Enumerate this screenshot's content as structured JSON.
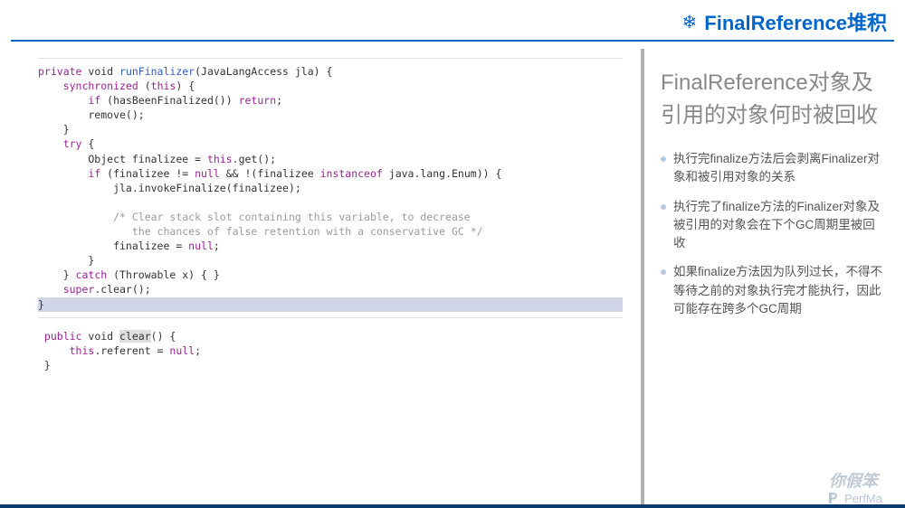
{
  "header": {
    "icon": "❄",
    "title": "FinalReference堆积"
  },
  "code1": {
    "line1_a": "private",
    "line1_b": " void ",
    "line1_c": "runFinalizer",
    "line1_d": "(JavaLangAccess jla) {",
    "line2_a": "    synchronized",
    "line2_b": " (",
    "line2_c": "this",
    "line2_d": ") {",
    "line3_a": "        if",
    "line3_b": " (hasBeenFinalized()) ",
    "line3_c": "return",
    "line3_d": ";",
    "line4": "        remove();",
    "line5": "    }",
    "line6_a": "    try",
    "line6_b": " {",
    "line7_a": "        Object finalizee = ",
    "line7_b": "this",
    "line7_c": ".get();",
    "line8_a": "        if",
    "line8_b": " (finalizee != ",
    "line8_c": "null",
    "line8_d": " && !(finalizee ",
    "line8_e": "instanceof",
    "line8_f": " java.lang.Enum)) {",
    "line9": "            jla.invokeFinalize(finalizee);",
    "line10": "",
    "line11_a": "            /* Clear stack slot containing this variable, to decrease",
    "line12_a": "               the chances of false retention with a conservative GC */",
    "line13_a": "            finalizee = ",
    "line13_b": "null",
    "line13_c": ";",
    "line14": "        }",
    "line15_a": "    } ",
    "line15_b": "catch",
    "line15_c": " (Throwable x) { }",
    "line16_a": "    super",
    "line16_b": ".clear();",
    "line17": "}"
  },
  "code2": {
    "line1_a": " public",
    "line1_b": " void ",
    "line1_c": "clear",
    "line1_d": "() {",
    "line2_a": "     this",
    "line2_b": ".referent = ",
    "line2_c": "null",
    "line2_d": ";",
    "line3": " }"
  },
  "subtitle": "FinalReference对象及引用的对象何时被回收",
  "bullets": [
    "执行完finalize方法后会剥离Finalizer对象和被引用对象的关系",
    "执行完了finalize方法的Finalizer对象及被引用的对象会在下个GC周期里被回收",
    "如果finalize方法因为队列过长，不得不等待之前的对象执行完才能执行，因此可能存在跨多个GC周期"
  ],
  "watermark": "你假笨",
  "brand": "PerfMa"
}
